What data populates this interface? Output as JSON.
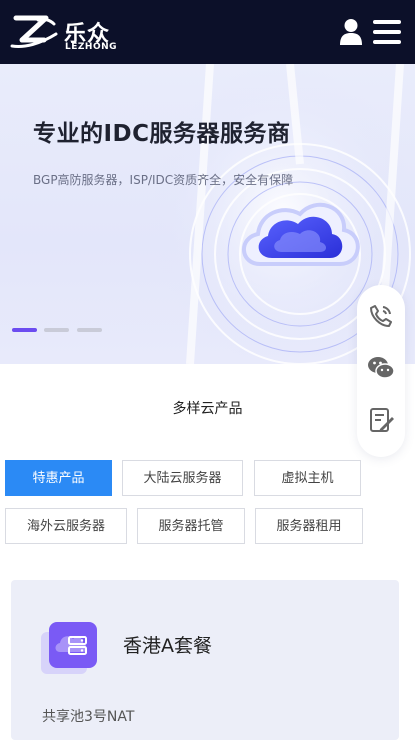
{
  "header": {
    "logo_cn": "乐众",
    "logo_en": "LEZHONG",
    "icons": {
      "user": "user-icon",
      "menu": "hamburger-menu-icon"
    }
  },
  "banner": {
    "title": "专业的IDC服务器服务商",
    "subtitle": "BGP高防服务器，ISP/IDC资质齐全，安全有保障",
    "slide_count": 3,
    "active_slide": 1
  },
  "floatbar": {
    "icons": [
      "phone-icon",
      "wechat-icon",
      "feedback-icon"
    ]
  },
  "products": {
    "section_title": "多样云产品",
    "tabs": [
      {
        "label": "特惠产品",
        "active": true
      },
      {
        "label": "大陆云服务器",
        "active": false
      },
      {
        "label": "虚拟主机",
        "active": false
      },
      {
        "label": "海外云服务器",
        "active": false
      },
      {
        "label": "服务器托管",
        "active": false
      },
      {
        "label": "服务器租用",
        "active": false
      }
    ],
    "card": {
      "name": "香港A套餐",
      "desc": "共享池3号NAT",
      "icon": "server-cloud-icon"
    }
  },
  "colors": {
    "header_bg": "#0c1029",
    "accent": "#2b8af5",
    "slide_active": "#6c4cf0",
    "icon_purple": "#7a5af5"
  }
}
